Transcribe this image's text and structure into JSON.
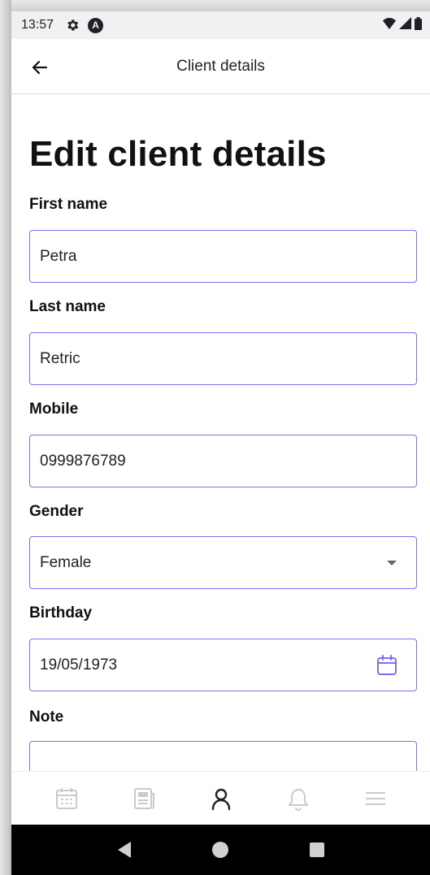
{
  "status_bar": {
    "time": "13:57",
    "icons": [
      "gear-icon",
      "accessibility-a-icon",
      "wifi-icon",
      "signal-icon",
      "battery-icon"
    ],
    "accessibility_letter": "A"
  },
  "app_bar": {
    "title": "Client details",
    "back_icon": "arrow-left-icon"
  },
  "form": {
    "heading": "Edit client details",
    "first_name": {
      "label": "First name",
      "value": "Petra"
    },
    "last_name": {
      "label": "Last name",
      "value": "Retric"
    },
    "mobile": {
      "label": "Mobile",
      "value": "0999876789"
    },
    "gender": {
      "label": "Gender",
      "value": "Female"
    },
    "birthday": {
      "label": "Birthday",
      "value": "19/05/1973"
    },
    "note": {
      "label": "Note",
      "value": ""
    }
  },
  "bottom_nav": {
    "items": [
      "calendar-icon",
      "newspaper-icon",
      "person-icon",
      "bell-icon",
      "menu-icon"
    ],
    "active_index": 2
  },
  "colors": {
    "accent": "#7b6ff0",
    "inactive_icon": "#c9c9cf",
    "active_icon": "#222222"
  }
}
